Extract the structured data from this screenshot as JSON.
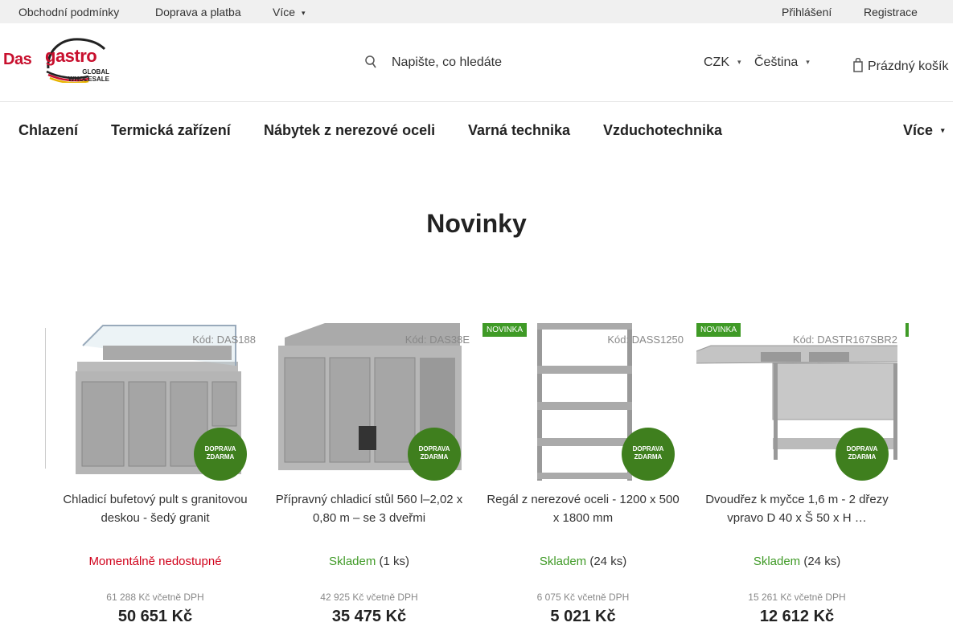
{
  "topbar": {
    "links": [
      "Obchodní podmínky",
      "Doprava a platba"
    ],
    "more_label": "Více",
    "login": "Přihlášení",
    "register": "Registrace"
  },
  "header": {
    "logo": {
      "word1": "Das",
      "word2": "gastro",
      "tag1": "GLOBAL",
      "tag2": "WHOLESALE"
    },
    "search_placeholder": "Napište, co hledáte",
    "currency": "CZK",
    "language": "Čeština",
    "cart": "Prázdný košík"
  },
  "nav": {
    "items": [
      "Chlazení",
      "Termická zařízení",
      "Nábytek z nerezové oceli",
      "Varná technika",
      "Vzduchotechnika"
    ],
    "more": "Více"
  },
  "section_title": "Novinky",
  "colors": {
    "green": "#3f9a26",
    "badge_green": "#3f7f1e",
    "red": "#d0021b",
    "brand_red": "#c8102e"
  },
  "products": [
    {
      "code": "Kód: DAS188",
      "new_badge": "",
      "free_shipping": [
        "DOPRAVA",
        "ZDARMA"
      ],
      "name": "Chladicí bufetový pult s granitovou deskou - šedý granit",
      "stock_status": "Momentálně nedostupné",
      "stock_count": "",
      "price_vat": "61 288 Kč včetně DPH",
      "price": "50 651 Kč"
    },
    {
      "code": "Kód: DAS38E",
      "new_badge": "",
      "free_shipping": [
        "DOPRAVA",
        "ZDARMA"
      ],
      "name": "Přípravný chladicí stůl 560 l–2,02 x 0,80 m – se 3 dveřmi",
      "stock_status": "Skladem",
      "stock_count": "(1 ks)",
      "price_vat": "42 925 Kč včetně DPH",
      "price": "35 475 Kč"
    },
    {
      "code": "Kód: DASS1250",
      "new_badge": "NOVINKA",
      "free_shipping": [
        "DOPRAVA",
        "ZDARMA"
      ],
      "name": "Regál z nerezové oceli - 1200 x 500 x 1800 mm",
      "stock_status": "Skladem",
      "stock_count": "(24 ks)",
      "price_vat": "6 075 Kč včetně DPH",
      "price": "5 021 Kč"
    },
    {
      "code": "Kód: DASTR167SBR2",
      "new_badge": "NOVINKA",
      "free_shipping": [
        "DOPRAVA",
        "ZDARMA"
      ],
      "name": "Dvoudřez k myčce 1,6 m - 2 dřezy vpravo D 40 x Š 50 x H …",
      "stock_status": "Skladem",
      "stock_count": "(24 ks)",
      "price_vat": "15 261 Kč včetně DPH",
      "price": "12 612 Kč"
    }
  ]
}
